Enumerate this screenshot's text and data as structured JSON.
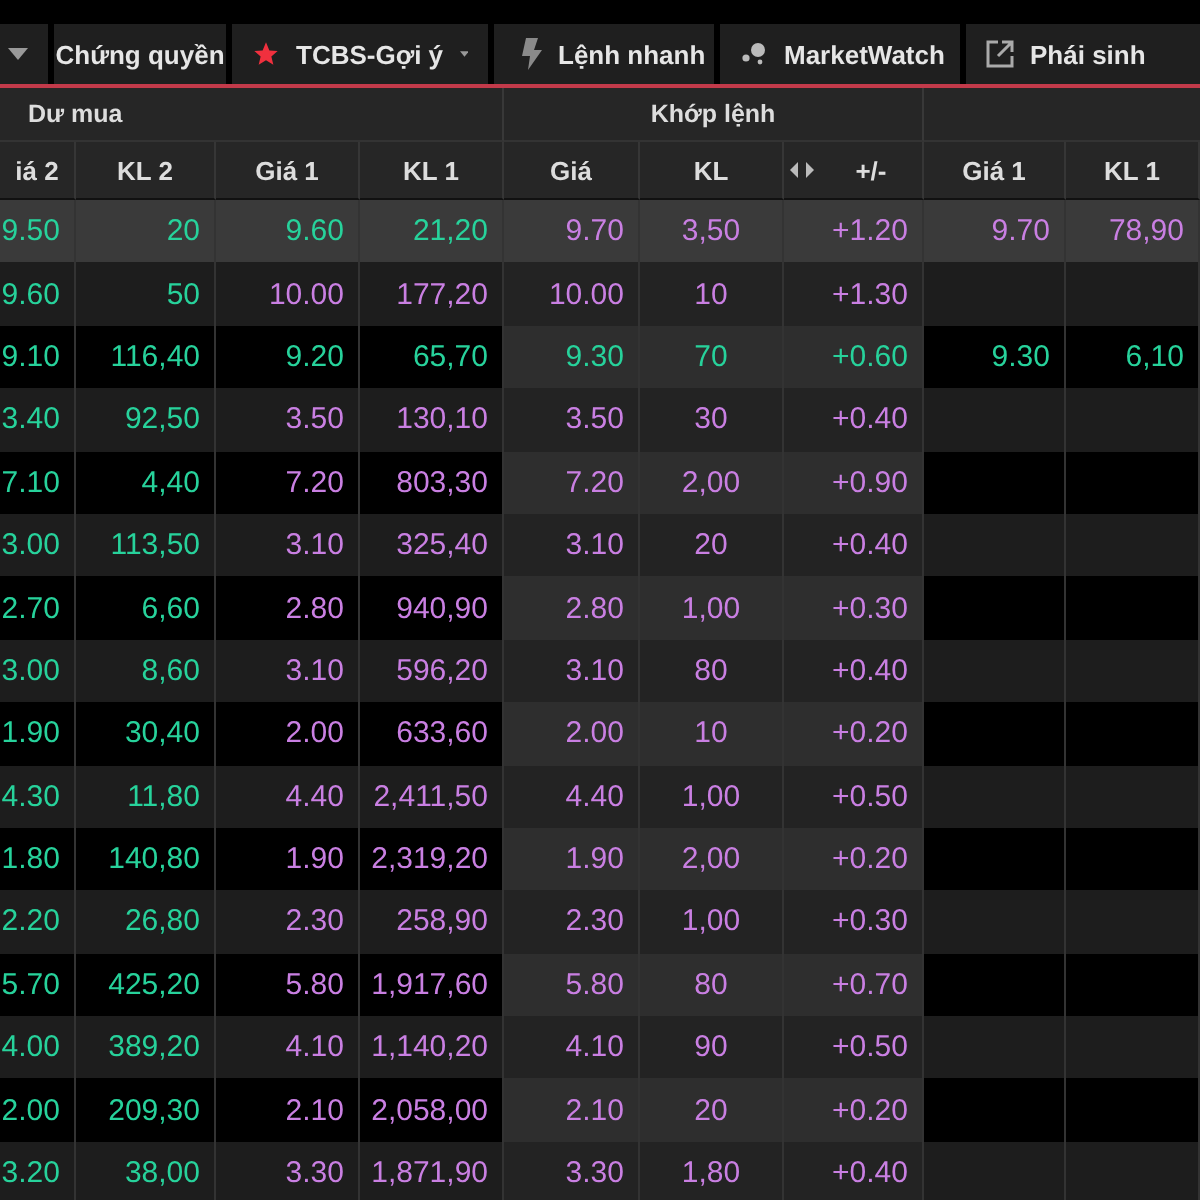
{
  "toolbar": [
    {
      "kind": "caret"
    },
    {
      "kind": "plain",
      "label": "Chứng quyền"
    },
    {
      "kind": "star-dropdown",
      "label": "TCBS-Gợi ý"
    },
    {
      "kind": "bolt",
      "label": "Lệnh nhanh"
    },
    {
      "kind": "dots",
      "label": "MarketWatch"
    },
    {
      "kind": "external",
      "label": "Phái sinh"
    }
  ],
  "groups": [
    "Dư mua",
    "Khớp lệnh"
  ],
  "columns": [
    "iá 2",
    "KL 2",
    "Giá 1",
    "KL 1",
    "Giá",
    "KL",
    "+/-",
    "Giá 1",
    "KL 1"
  ],
  "rows": [
    {
      "selected": true,
      "bid2": {
        "color": "#27d29b",
        "values": [
          "9.50",
          "20"
        ]
      },
      "bid1": {
        "color": "#27d29b",
        "values": [
          "9.60",
          "21,20"
        ]
      },
      "match": {
        "color": "#c97fe2",
        "values": [
          "9.70",
          "3,50",
          "+1.20"
        ]
      },
      "ask": {
        "color": "#c97fe2",
        "values": [
          "9.70",
          "78,90"
        ]
      }
    },
    {
      "selected": false,
      "bid2": {
        "color": "#27d29b",
        "values": [
          "9.60",
          "50"
        ]
      },
      "bid1": {
        "color": "#c97fe2",
        "values": [
          "10.00",
          "177,20"
        ]
      },
      "match": {
        "color": "#c97fe2",
        "values": [
          "10.00",
          "10",
          "+1.30"
        ]
      }
    },
    {
      "selected": false,
      "bid2": {
        "color": "#27d29b",
        "values": [
          "9.10",
          "116,40"
        ]
      },
      "bid1": {
        "color": "#27d29b",
        "values": [
          "9.20",
          "65,70"
        ]
      },
      "match": {
        "color": "#27d29b",
        "values": [
          "9.30",
          "70",
          "+0.60"
        ]
      },
      "ask": {
        "color": "#27d29b",
        "values": [
          "9.30",
          "6,10"
        ]
      }
    },
    {
      "selected": false,
      "bid2": {
        "color": "#27d29b",
        "values": [
          "3.40",
          "92,50"
        ]
      },
      "bid1": {
        "color": "#c97fe2",
        "values": [
          "3.50",
          "130,10"
        ]
      },
      "match": {
        "color": "#c97fe2",
        "values": [
          "3.50",
          "30",
          "+0.40"
        ]
      }
    },
    {
      "selected": false,
      "bid2": {
        "color": "#27d29b",
        "values": [
          "7.10",
          "4,40"
        ]
      },
      "bid1": {
        "color": "#c97fe2",
        "values": [
          "7.20",
          "803,30"
        ]
      },
      "match": {
        "color": "#c97fe2",
        "values": [
          "7.20",
          "2,00",
          "+0.90"
        ]
      }
    },
    {
      "selected": false,
      "bid2": {
        "color": "#27d29b",
        "values": [
          "3.00",
          "113,50"
        ]
      },
      "bid1": {
        "color": "#c97fe2",
        "values": [
          "3.10",
          "325,40"
        ]
      },
      "match": {
        "color": "#c97fe2",
        "values": [
          "3.10",
          "20",
          "+0.40"
        ]
      }
    },
    {
      "selected": false,
      "bid2": {
        "color": "#27d29b",
        "values": [
          "2.70",
          "6,60"
        ]
      },
      "bid1": {
        "color": "#c97fe2",
        "values": [
          "2.80",
          "940,90"
        ]
      },
      "match": {
        "color": "#c97fe2",
        "values": [
          "2.80",
          "1,00",
          "+0.30"
        ]
      }
    },
    {
      "selected": false,
      "bid2": {
        "color": "#27d29b",
        "values": [
          "3.00",
          "8,60"
        ]
      },
      "bid1": {
        "color": "#c97fe2",
        "values": [
          "3.10",
          "596,20"
        ]
      },
      "match": {
        "color": "#c97fe2",
        "values": [
          "3.10",
          "80",
          "+0.40"
        ]
      }
    },
    {
      "selected": false,
      "bid2": {
        "color": "#27d29b",
        "values": [
          "1.90",
          "30,40"
        ]
      },
      "bid1": {
        "color": "#c97fe2",
        "values": [
          "2.00",
          "633,60"
        ]
      },
      "match": {
        "color": "#c97fe2",
        "values": [
          "2.00",
          "10",
          "+0.20"
        ]
      }
    },
    {
      "selected": false,
      "bid2": {
        "color": "#27d29b",
        "values": [
          "4.30",
          "11,80"
        ]
      },
      "bid1": {
        "color": "#c97fe2",
        "values": [
          "4.40",
          "2,411,50"
        ]
      },
      "match": {
        "color": "#c97fe2",
        "values": [
          "4.40",
          "1,00",
          "+0.50"
        ]
      }
    },
    {
      "selected": false,
      "bid2": {
        "color": "#27d29b",
        "values": [
          "1.80",
          "140,80"
        ]
      },
      "bid1": {
        "color": "#c97fe2",
        "values": [
          "1.90",
          "2,319,20"
        ]
      },
      "match": {
        "color": "#c97fe2",
        "values": [
          "1.90",
          "2,00",
          "+0.20"
        ]
      }
    },
    {
      "selected": false,
      "bid2": {
        "color": "#27d29b",
        "values": [
          "2.20",
          "26,80"
        ]
      },
      "bid1": {
        "color": "#c97fe2",
        "values": [
          "2.30",
          "258,90"
        ]
      },
      "match": {
        "color": "#c97fe2",
        "values": [
          "2.30",
          "1,00",
          "+0.30"
        ]
      }
    },
    {
      "selected": false,
      "bid2": {
        "color": "#27d29b",
        "values": [
          "5.70",
          "425,20"
        ]
      },
      "bid1": {
        "color": "#c97fe2",
        "values": [
          "5.80",
          "1,917,60"
        ]
      },
      "match": {
        "color": "#c97fe2",
        "values": [
          "5.80",
          "80",
          "+0.70"
        ]
      }
    },
    {
      "selected": false,
      "bid2": {
        "color": "#27d29b",
        "values": [
          "4.00",
          "389,20"
        ]
      },
      "bid1": {
        "color": "#c97fe2",
        "values": [
          "4.10",
          "1,140,20"
        ]
      },
      "match": {
        "color": "#c97fe2",
        "values": [
          "4.10",
          "90",
          "+0.50"
        ]
      }
    },
    {
      "selected": false,
      "bid2": {
        "color": "#27d29b",
        "values": [
          "2.00",
          "209,30"
        ]
      },
      "bid1": {
        "color": "#c97fe2",
        "values": [
          "2.10",
          "2,058,00"
        ]
      },
      "match": {
        "color": "#c97fe2",
        "values": [
          "2.10",
          "20",
          "+0.20"
        ]
      }
    },
    {
      "selected": false,
      "bid2": {
        "color": "#27d29b",
        "values": [
          "3.20",
          "38,00"
        ]
      },
      "bid1": {
        "color": "#c97fe2",
        "values": [
          "3.30",
          "1,871,90"
        ]
      },
      "match": {
        "color": "#c97fe2",
        "values": [
          "3.30",
          "1,80",
          "+0.40"
        ]
      }
    }
  ]
}
